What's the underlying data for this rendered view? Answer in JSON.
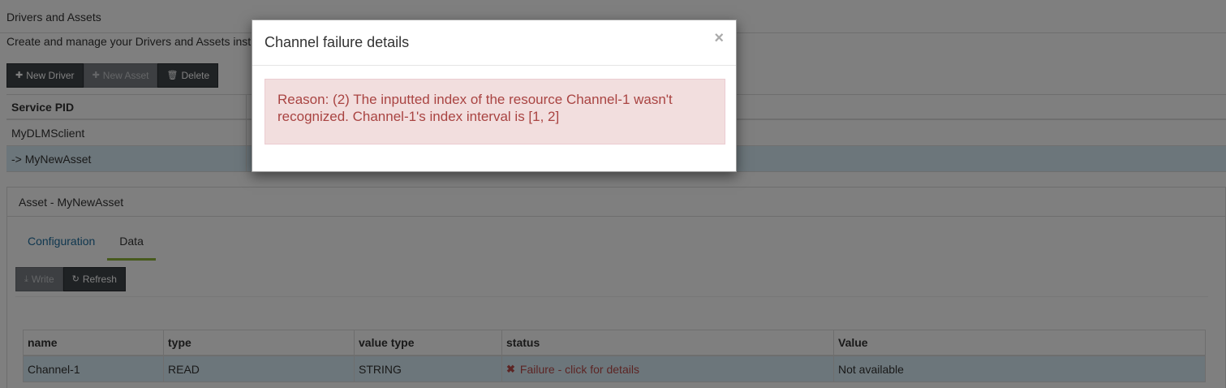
{
  "page": {
    "title": "Drivers and Assets",
    "description": "Create and manage your Drivers and Assets inst"
  },
  "toolbar": {
    "new_driver": "New Driver",
    "new_asset": "New Asset",
    "delete": "Delete"
  },
  "main_table": {
    "header": "Service PID",
    "rows": [
      "MyDLMSclient",
      "-> MyNewAsset"
    ]
  },
  "asset_panel": {
    "heading": "Asset - MyNewAsset",
    "tabs": [
      "Configuration",
      "Data"
    ],
    "write": "Write",
    "refresh": "Refresh"
  },
  "data_table": {
    "headers": [
      "name",
      "type",
      "value type",
      "status",
      "Value"
    ],
    "row": {
      "name": "Channel-1",
      "type": "READ",
      "value_type": "STRING",
      "status": "Failure - click for details",
      "value": "Not available"
    }
  },
  "modal": {
    "title": "Channel failure details",
    "close": "×",
    "message": "Reason: (2) The inputted index of the resource Channel-1 wasn't recognized. Channel-1's index interval is [1, 2]"
  },
  "colors": {
    "alert_bg": "#f2dede",
    "alert_text": "#a94442",
    "active_tab_underline": "#8fb43a",
    "selected_row": "#d9edf7"
  }
}
